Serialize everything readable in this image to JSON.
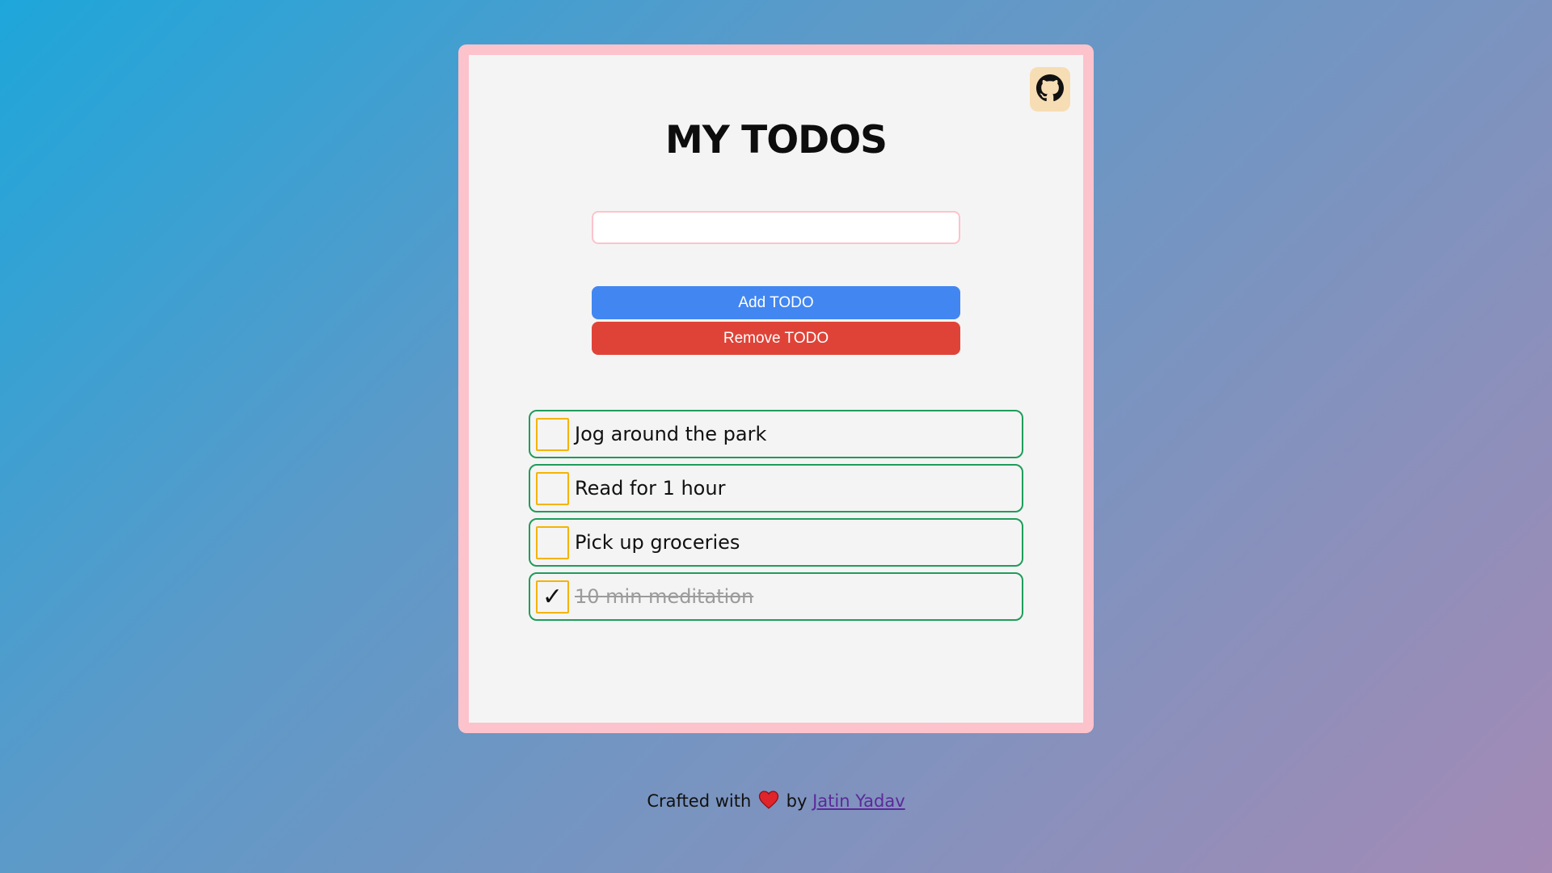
{
  "app": {
    "title": "MY TODOS",
    "github_icon": "github-icon"
  },
  "form": {
    "input_value": "",
    "input_placeholder": "",
    "add_label": "Add TODO",
    "remove_label": "Remove TODO"
  },
  "todos": [
    {
      "text": "Jog around the park",
      "done": false
    },
    {
      "text": "Read for 1 hour",
      "done": false
    },
    {
      "text": "Pick up groceries",
      "done": false
    },
    {
      "text": "10 min meditation",
      "done": true
    }
  ],
  "footer": {
    "prefix": "Crafted with",
    "heart_icon": "heart-icon",
    "by": "by",
    "author": "Jatin Yadav"
  },
  "colors": {
    "card_border": "#fcc3cc",
    "add_button": "#4286f1",
    "remove_button": "#df4338",
    "item_border": "#1e9d5a",
    "checkbox_border": "#f4b400",
    "github_bg": "#f7ddb4"
  }
}
